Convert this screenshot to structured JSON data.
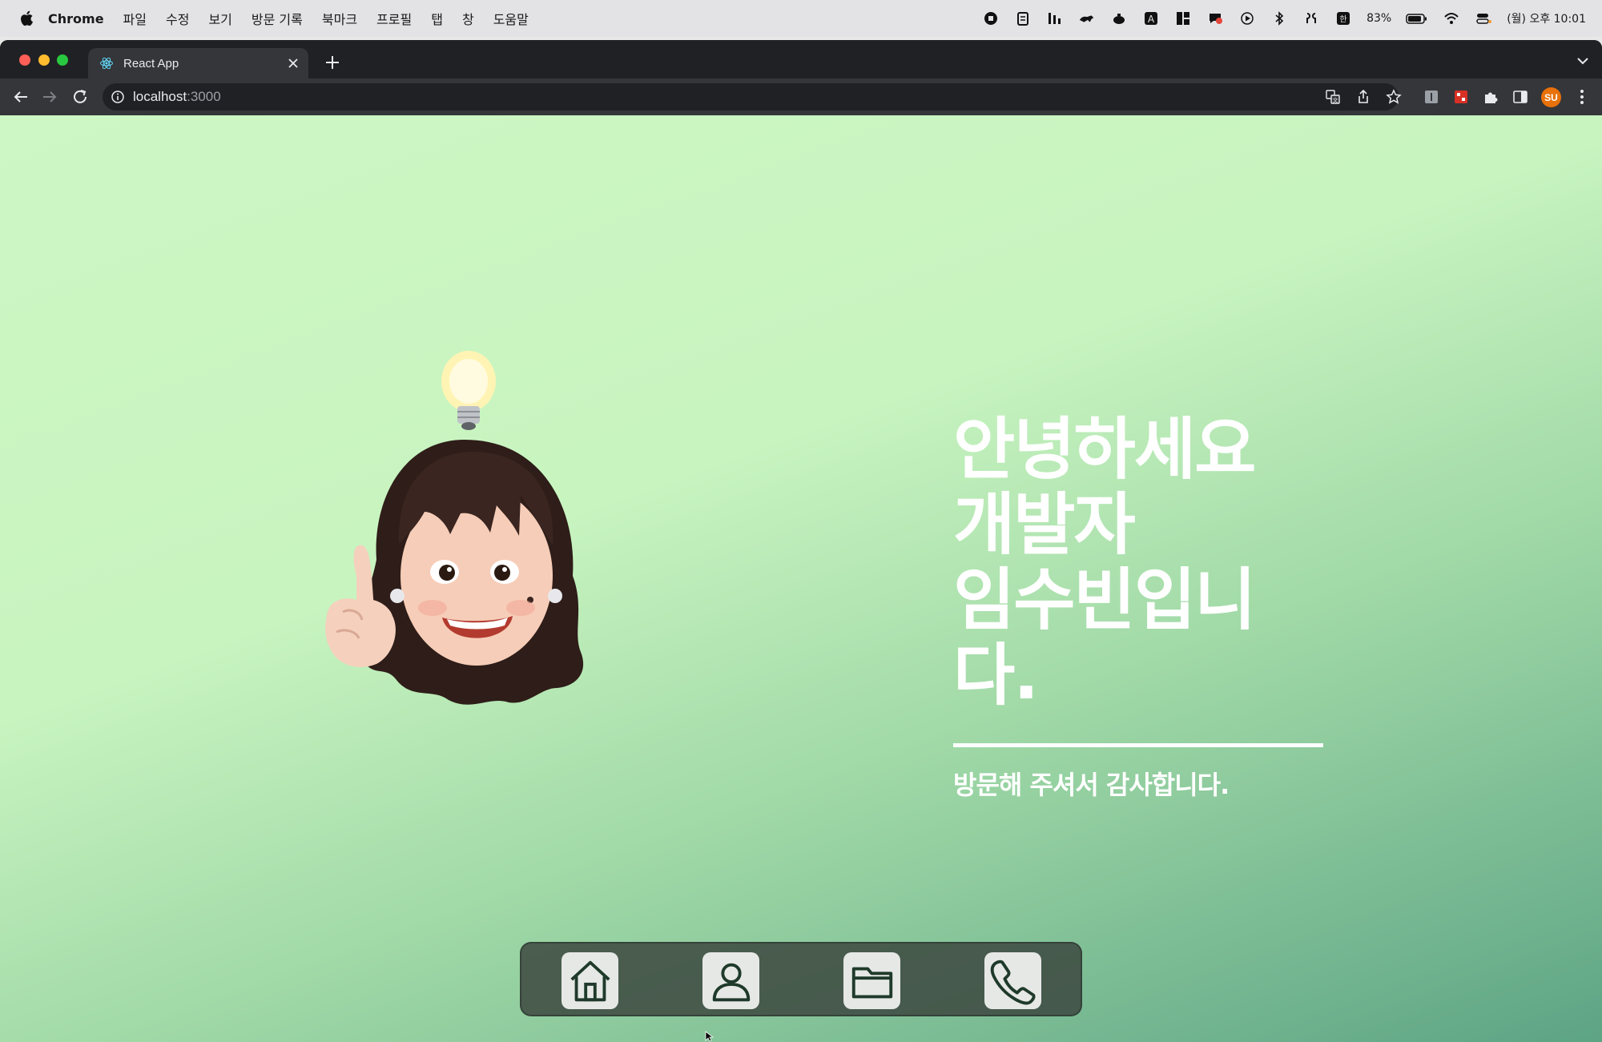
{
  "menubar": {
    "app_name": "Chrome",
    "menus": [
      "파일",
      "수정",
      "보기",
      "방문 기록",
      "북마크",
      "프로필",
      "탭",
      "창",
      "도움말"
    ],
    "battery": "83%",
    "clock": "(월) 오후 10:01"
  },
  "browser": {
    "tab_title": "React App",
    "url_host": "localhost",
    "url_port": ":3000",
    "profile_initials": "SU"
  },
  "hero": {
    "line1": "안녕하세요",
    "line2": "개발자",
    "line3": "임수빈입니다.",
    "subtitle": "방문해 주셔서 감사합니다."
  },
  "dock": {
    "items": [
      {
        "icon": "house-icon"
      },
      {
        "icon": "person-icon"
      },
      {
        "icon": "folder-icon"
      },
      {
        "icon": "phone-icon"
      }
    ]
  },
  "colors": {
    "gradient_start": "#cdf7c4",
    "gradient_end": "#5da485",
    "dock_bg": "#3c4840",
    "icon_stroke": "#1f3a2a"
  }
}
